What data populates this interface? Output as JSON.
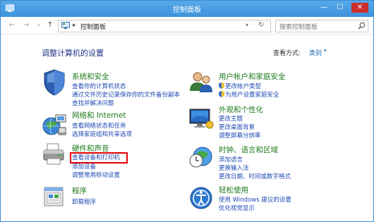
{
  "window": {
    "title": "控制面板"
  },
  "titlebar": {
    "minimize": "—",
    "maximize": "☐",
    "close": "✕"
  },
  "nav": {
    "back": "←",
    "forward": "→",
    "up": "↑"
  },
  "address": {
    "separator": "▸",
    "path": "控制面板",
    "dropdown": "▾",
    "refresh": "↻"
  },
  "search": {
    "placeholder": "搜索控制面板"
  },
  "main": {
    "title": "调整计算机的设置",
    "view_by_label": "查看方式:",
    "view_by_value": "类别",
    "view_by_dropdown": "▾"
  },
  "categories": [
    {
      "title": "系统和安全",
      "links": [
        "查看你的计算机状态",
        "通过文件历史记录保存你的文件备份副本",
        "查找并解决问题"
      ]
    },
    {
      "title": "网络和 Internet",
      "links": [
        "查看网络状态和任务",
        "选择家庭组和共享选项"
      ]
    },
    {
      "title": "硬件和声音",
      "links": [
        "查看设备和打印机",
        "添加设备",
        "调整常用移动设置"
      ]
    },
    {
      "title": "程序",
      "links": [
        "卸载程序"
      ]
    },
    {
      "title": "用户帐户和家庭安全",
      "links": [
        "更改帐户类型",
        "为用户设置家庭安全"
      ]
    },
    {
      "title": "外观和个性化",
      "links": [
        "更改主题",
        "更改桌面背景",
        "调整屏幕分辨率"
      ]
    },
    {
      "title": "时钟、语言和区域",
      "links": [
        "添加语言",
        "更换输入法",
        "更改日期、时间或数字格式"
      ]
    },
    {
      "title": "轻松使用",
      "links": [
        "使用 Windows 建议的设置",
        "优化视觉显示"
      ]
    }
  ],
  "colors": {
    "titlebar": "#3d93dc",
    "category_title": "#1f7a1f",
    "link": "#1e4ab4",
    "highlight": "#e00000"
  }
}
